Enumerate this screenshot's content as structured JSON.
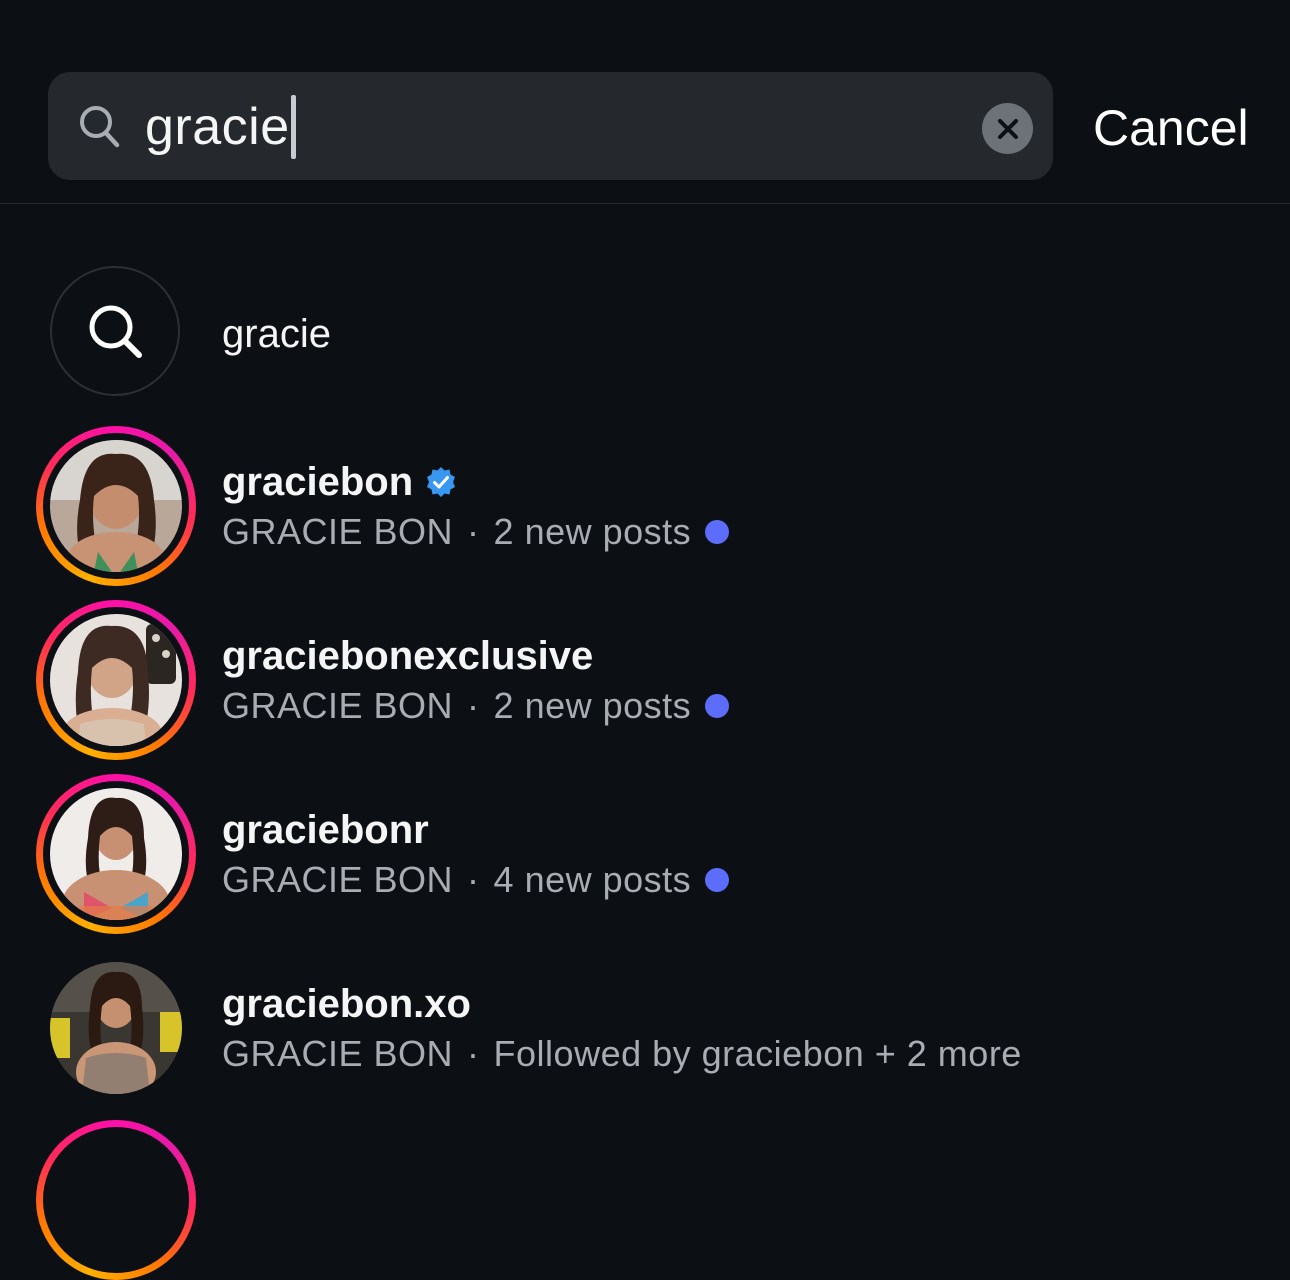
{
  "search": {
    "value": "gracie",
    "cancel_label": "Cancel"
  },
  "query_suggestion": {
    "text": "gracie"
  },
  "results": [
    {
      "username": "graciebon",
      "verified": true,
      "full_name": "GRACIE BON",
      "separator": "·",
      "detail": "2 new posts",
      "has_story": true,
      "unread": true
    },
    {
      "username": "graciebonexclusive",
      "verified": false,
      "full_name": "GRACIE BON",
      "separator": "·",
      "detail": "2 new posts",
      "has_story": true,
      "unread": true
    },
    {
      "username": "graciebonr",
      "verified": false,
      "full_name": "GRACIE BON",
      "separator": "·",
      "detail": "4 new posts",
      "has_story": true,
      "unread": true
    },
    {
      "username": "graciebon.xo",
      "verified": false,
      "full_name": "GRACIE BON",
      "separator": "·",
      "detail": "Followed by graciebon + 2 more",
      "has_story": false,
      "unread": false
    }
  ],
  "colors": {
    "background": "#0c1014",
    "search_field": "#25292e",
    "secondary_text": "#a8adb3",
    "unread_dot": "#5b6dfa",
    "verified_badge": "#3897f0"
  },
  "icons": [
    "search-icon",
    "clear-icon",
    "verified-badge-icon"
  ]
}
